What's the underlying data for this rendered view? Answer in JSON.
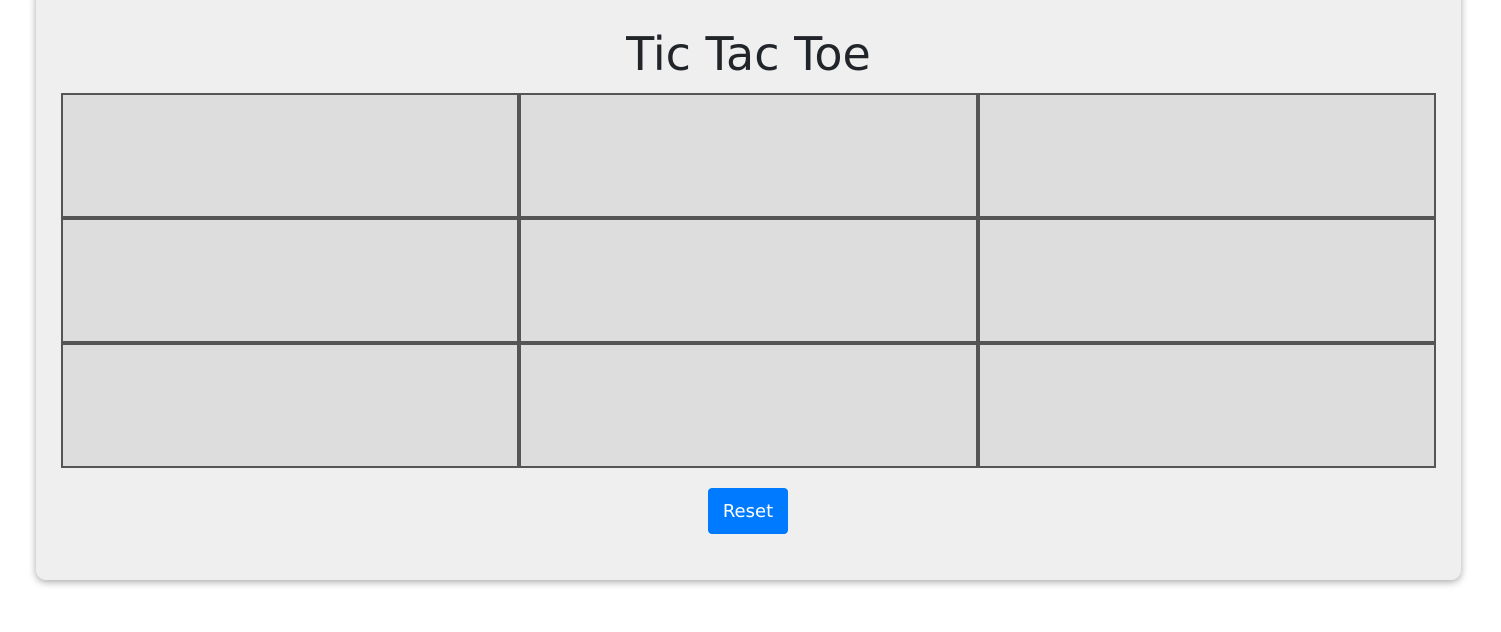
{
  "game": {
    "title": "Tic Tac Toe",
    "board": [
      [
        "",
        "",
        ""
      ],
      [
        "",
        "",
        ""
      ],
      [
        "",
        "",
        ""
      ]
    ],
    "reset_label": "Reset"
  },
  "colors": {
    "card_background": "#efefef",
    "cell_background": "#dddddd",
    "grid_line": "#555555",
    "reset_button": "#007bff",
    "title_text": "#212529"
  }
}
